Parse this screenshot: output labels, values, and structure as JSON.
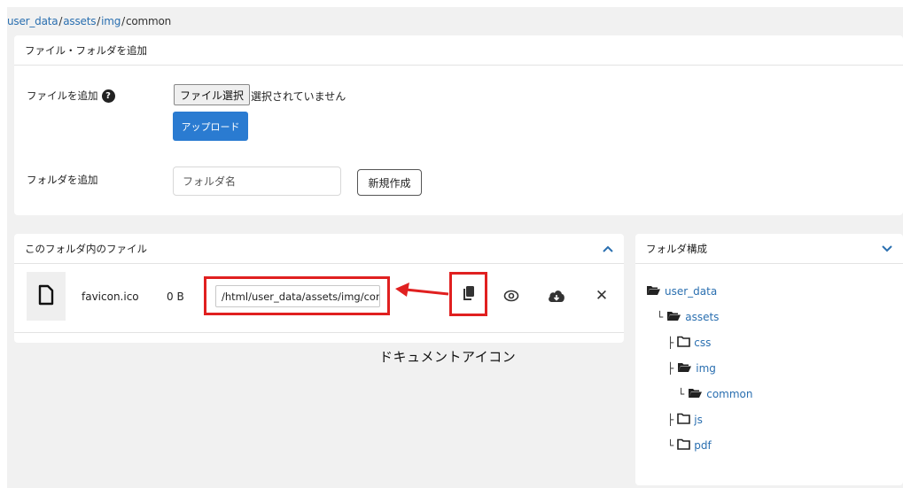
{
  "breadcrumb": {
    "items": [
      "user_data",
      "assets",
      "img"
    ],
    "current": "common",
    "separator": "/"
  },
  "add_panel": {
    "title": "ファイル・フォルダを追加",
    "file_label": "ファイルを追加",
    "file_button": "ファイル選択",
    "file_status": "選択されていません",
    "upload_button": "アップロード",
    "folder_label": "フォルダを追加",
    "folder_placeholder": "フォルダ名",
    "create_button": "新規作成"
  },
  "files_panel": {
    "title": "このフォルダ内のファイル",
    "files": [
      {
        "name": "favicon.ico",
        "size": "0 B",
        "path": "/html/user_data/assets/img/common/favicon.ico",
        "icons": [
          "copy-icon",
          "eye-icon",
          "cloud-download-icon",
          "close-icon"
        ]
      }
    ]
  },
  "annotation": "ドキュメントアイコン",
  "tree_panel": {
    "title": "フォルダ構成",
    "items": [
      {
        "label": "user_data",
        "branch": "",
        "open": true
      },
      {
        "label": "assets",
        "branch": "└",
        "open": true
      },
      {
        "label": "css",
        "branch": "├",
        "open": false
      },
      {
        "label": "img",
        "branch": "├",
        "open": true
      },
      {
        "label": "common",
        "branch": "└",
        "open": true
      },
      {
        "label": "js",
        "branch": "├",
        "open": false
      },
      {
        "label": "pdf",
        "branch": "└",
        "open": false
      }
    ]
  },
  "colors": {
    "accent": "#2a6fb0",
    "primary_button": "#2a7bd1",
    "highlight": "#e02020",
    "background": "#f1f1f1"
  }
}
